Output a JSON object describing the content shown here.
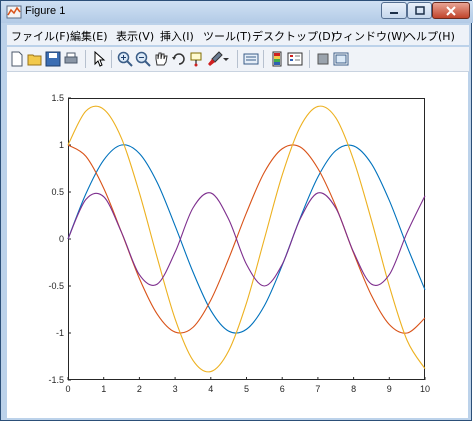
{
  "window": {
    "title": "Figure 1"
  },
  "menu": [
    "ファイル(F)",
    "編集(E)",
    "表示(V)",
    "挿入(I)",
    "ツール(T)",
    "デスクトップ(D)",
    "ウィンドウ(W)",
    "ヘルプ(H)"
  ],
  "toolbar_icons": [
    "new-figure-icon",
    "open-file-icon",
    "save-icon",
    "print-icon",
    "edit-plot-arrow-icon",
    "zoom-in-icon",
    "zoom-out-icon",
    "pan-hand-icon",
    "rotate-3d-icon",
    "data-cursor-icon",
    "brush-icon",
    "link-plot-icon",
    "insert-colorbar-icon",
    "insert-legend-icon",
    "hide-plot-tools-icon",
    "show-plot-tools-icon"
  ],
  "chart_data": {
    "type": "line",
    "xlim": [
      0,
      10
    ],
    "ylim": [
      -1.5,
      1.5
    ],
    "xticks": [
      "0",
      "1",
      "2",
      "3",
      "4",
      "5",
      "6",
      "7",
      "8",
      "9",
      "10"
    ],
    "yticks": [
      "1.5",
      "1",
      "0.5",
      "0",
      "-0.5",
      "-1",
      "-1.5"
    ],
    "x": [
      0,
      0.5,
      1,
      1.5,
      2,
      2.5,
      3,
      3.5,
      4,
      4.5,
      5,
      5.5,
      6,
      6.5,
      7,
      7.5,
      8,
      8.5,
      9,
      9.5,
      10
    ],
    "series": [
      {
        "color": "#0072bd",
        "values": [
          0,
          0.48,
          0.84,
          1.0,
          0.91,
          0.6,
          0.14,
          -0.35,
          -0.76,
          -0.98,
          -0.96,
          -0.71,
          -0.28,
          0.22,
          0.66,
          0.94,
          0.99,
          0.8,
          0.41,
          -0.08,
          -0.54
        ]
      },
      {
        "color": "#d95319",
        "values": [
          1.0,
          0.88,
          0.54,
          0.07,
          -0.42,
          -0.8,
          -0.99,
          -0.94,
          -0.65,
          -0.21,
          0.28,
          0.71,
          0.96,
          0.98,
          0.75,
          0.35,
          -0.15,
          -0.6,
          -0.91,
          -1.0,
          -0.84
        ]
      },
      {
        "color": "#edb120",
        "values": [
          1.0,
          1.36,
          1.38,
          1.07,
          0.49,
          -0.2,
          -0.85,
          -1.29,
          -1.41,
          -1.19,
          -0.68,
          0.0,
          0.68,
          1.19,
          1.41,
          1.29,
          0.84,
          0.2,
          -0.5,
          -1.08,
          -1.38
        ]
      },
      {
        "color": "#7e2f8e",
        "values": [
          0,
          0.42,
          0.45,
          0.07,
          -0.38,
          -0.48,
          -0.14,
          0.33,
          0.49,
          0.21,
          -0.27,
          -0.5,
          -0.27,
          0.21,
          0.49,
          0.33,
          -0.14,
          -0.48,
          -0.38,
          0.07,
          0.46
        ]
      }
    ]
  }
}
